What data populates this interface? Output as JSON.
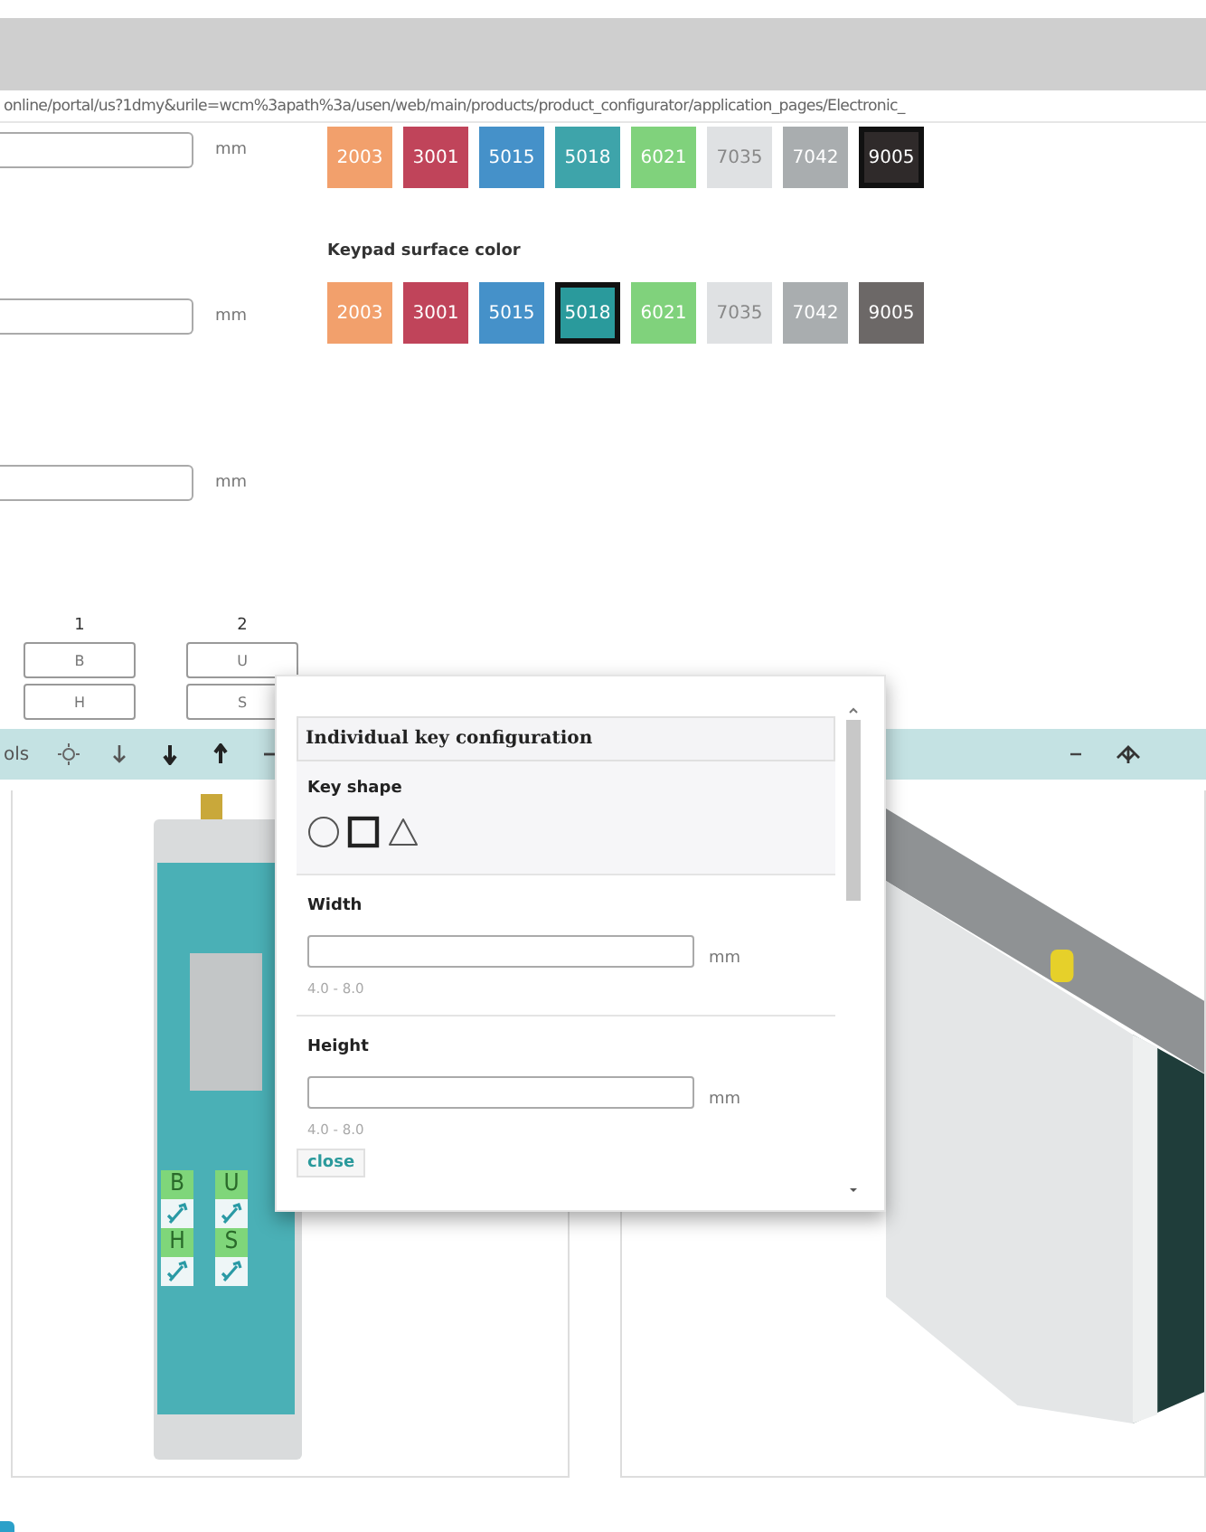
{
  "browser": {
    "url": "online/portal/us?1dmy&urile=wcm%3apath%3a/usen/web/main/products/product_configurator/application_pages/Electronic_"
  },
  "dimension_fields": [
    {
      "unit": "mm"
    },
    {
      "unit": "mm"
    },
    {
      "unit": "mm"
    }
  ],
  "housing_colors": {
    "swatches": [
      {
        "label": "2003",
        "color": "#f2a06c",
        "selected": false
      },
      {
        "label": "3001",
        "color": "#c0445a",
        "selected": false
      },
      {
        "label": "5015",
        "color": "#4591c9",
        "selected": false
      },
      {
        "label": "5018",
        "color": "#3ea4aa",
        "selected": false
      },
      {
        "label": "6021",
        "color": "#80d27c",
        "selected": false
      },
      {
        "label": "7035",
        "color": "#dfe1e3",
        "selected": false
      },
      {
        "label": "7042",
        "color": "#a9adaf",
        "selected": false
      },
      {
        "label": "9005",
        "color": "#2f2a2a",
        "selected": true
      }
    ]
  },
  "keypad_surface_color": {
    "title": "Keypad surface color",
    "swatches": [
      {
        "label": "2003",
        "color": "#f2a06c",
        "selected": false
      },
      {
        "label": "3001",
        "color": "#c0445a",
        "selected": false
      },
      {
        "label": "5015",
        "color": "#4591c9",
        "selected": false
      },
      {
        "label": "5018",
        "color": "#2a9a9c",
        "selected": true
      },
      {
        "label": "6021",
        "color": "#80d27c",
        "selected": false
      },
      {
        "label": "7035",
        "color": "#dfe1e3",
        "selected": false
      },
      {
        "label": "7042",
        "color": "#a9adaf",
        "selected": false
      },
      {
        "label": "9005",
        "color": "#6c6867",
        "selected": false
      }
    ]
  },
  "key_grid": {
    "columns": [
      {
        "heading": "1",
        "keys": [
          "B",
          "H"
        ]
      },
      {
        "heading": "2",
        "keys": [
          "U",
          "S"
        ]
      }
    ]
  },
  "toolbar": {
    "label": "ols"
  },
  "popup": {
    "title": "Individual key configuration",
    "key_shape": {
      "label": "Key shape",
      "shapes": [
        {
          "kind": "circle",
          "selected": false
        },
        {
          "kind": "square",
          "selected": true
        },
        {
          "kind": "triangle",
          "selected": false
        }
      ]
    },
    "fields": [
      {
        "label": "Width",
        "unit": "mm",
        "hint": "4.0 - 8.0"
      },
      {
        "label": "Height",
        "unit": "mm",
        "hint": "4.0 - 8.0"
      }
    ],
    "close": "close"
  },
  "device_keys": [
    "B",
    "U",
    "H",
    "S"
  ]
}
